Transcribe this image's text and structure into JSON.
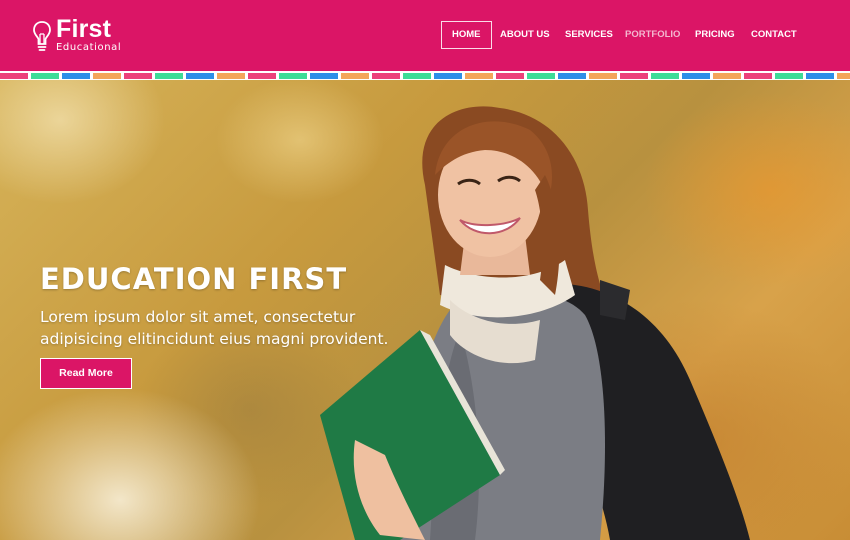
{
  "brand": {
    "title": "First",
    "subtitle": "Educational",
    "icon": "lightbulb-icon"
  },
  "nav": {
    "items": [
      {
        "label": "HOME",
        "active": true
      },
      {
        "label": "ABOUT US"
      },
      {
        "label": "SERVICES"
      },
      {
        "label": "PORTFOLIO",
        "muted": true
      },
      {
        "label": "PRICING"
      },
      {
        "label": "CONTACT"
      }
    ]
  },
  "hero": {
    "title": "EDUCATION FIRST",
    "text": "Lorem ipsum dolor sit amet, consectetur adipisicing elitincidunt eius magni provident.",
    "button_label": "Read More"
  },
  "colors": {
    "brand": "#db1566",
    "stripe": [
      "#ec407a",
      "#3ddc97",
      "#2e8ee8",
      "#f4a55a",
      "#ec407a",
      "#3ddc97",
      "#2e8ee8",
      "#f4a55a"
    ]
  }
}
